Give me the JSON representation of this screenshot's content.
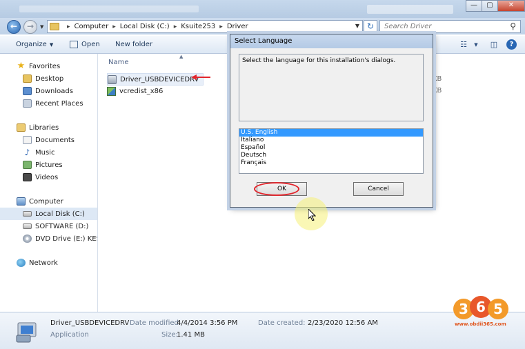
{
  "window": {
    "controls": {
      "minimize": "—",
      "maximize": "▢",
      "close": "✕"
    }
  },
  "address_bar": {
    "crumbs": [
      "Computer",
      "Local Disk (C:)",
      "Ksuite253",
      "Driver"
    ],
    "search_placeholder": "Search Driver"
  },
  "toolbar": {
    "organize_label": "Organize",
    "open_label": "Open",
    "new_folder_label": "New folder"
  },
  "sidebar": {
    "favorites": "Favorites",
    "favorites_items": [
      "Desktop",
      "Downloads",
      "Recent Places"
    ],
    "libraries": "Libraries",
    "libraries_items": [
      "Documents",
      "Music",
      "Pictures",
      "Videos"
    ],
    "computer": "Computer",
    "computer_items": [
      "Local Disk (C:)",
      "SOFTWARE (D:)",
      "DVD Drive (E:) KESS_"
    ],
    "network": "Network"
  },
  "content": {
    "column_name": "Name",
    "files": [
      {
        "name": "Driver_USBDEVICEDRV",
        "size_suffix": "KB"
      },
      {
        "name": "vcredist_x86",
        "size_suffix": "KB"
      }
    ]
  },
  "details": {
    "file_name": "Driver_USBDEVICEDRV",
    "file_type": "Application",
    "date_modified_label": "Date modified:",
    "date_modified": "4/4/2014 3:56 PM",
    "size_label": "Size:",
    "size": "1.41 MB",
    "date_created_label": "Date created:",
    "date_created": "2/23/2020 12:56 AM"
  },
  "dialog": {
    "title": "Select Language",
    "message": "Select the language for this installation's dialogs.",
    "languages": [
      "U.S. English",
      "Italiano",
      "Español",
      "Deutsch",
      "Français"
    ],
    "selected_language": "U.S. English",
    "ok_label": "OK",
    "cancel_label": "Cancel"
  },
  "watermark": {
    "url": "www.obdii365.com"
  },
  "colors": {
    "selection": "#3399ff",
    "annotation_red": "#e2262d",
    "watermark_orange": "#e0561e"
  }
}
